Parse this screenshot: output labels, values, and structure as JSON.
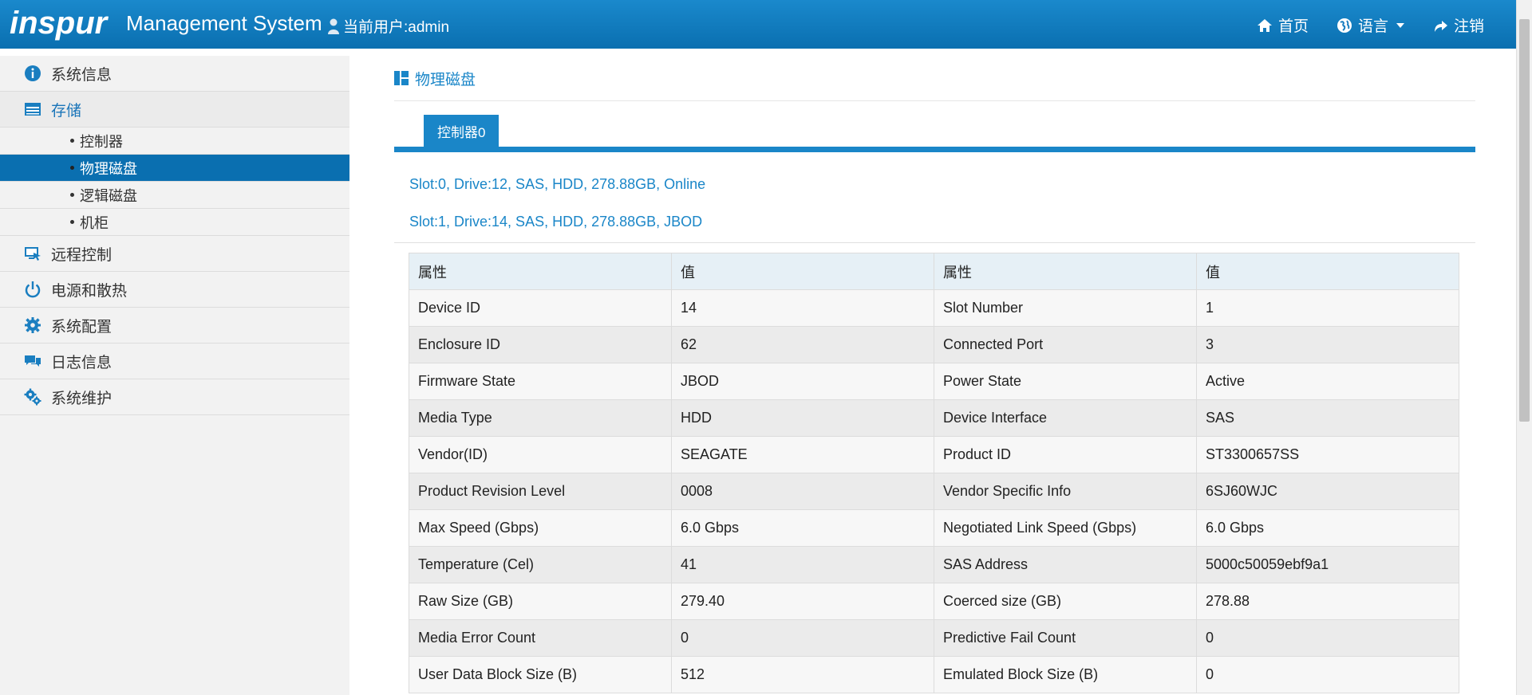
{
  "header": {
    "logo_text": "inspur",
    "app_title": "Management System",
    "user_label": "当前用户:admin",
    "nav": [
      {
        "label": "首页",
        "icon": "home-icon"
      },
      {
        "label": "语言",
        "icon": "globe-icon"
      },
      {
        "label": "注销",
        "icon": "logout-icon"
      }
    ]
  },
  "sidebar": {
    "items": [
      {
        "label": "系统信息",
        "icon": "info-icon"
      },
      {
        "label": "存储",
        "icon": "storage-icon"
      },
      {
        "label": "远程控制",
        "icon": "remote-control-icon"
      },
      {
        "label": "电源和散热",
        "icon": "power-icon"
      },
      {
        "label": "系统配置",
        "icon": "gear-icon"
      },
      {
        "label": "日志信息",
        "icon": "chat-icon"
      },
      {
        "label": "系统维护",
        "icon": "gears-icon"
      }
    ],
    "storage_sub": [
      {
        "label": "控制器"
      },
      {
        "label": "物理磁盘"
      },
      {
        "label": "逻辑磁盘"
      },
      {
        "label": "机柜"
      }
    ]
  },
  "main": {
    "page_title": "物理磁盘",
    "tab_label": "控制器0",
    "drives": [
      "Slot:0, Drive:12, SAS, HDD, 278.88GB, Online",
      "Slot:1, Drive:14, SAS, HDD, 278.88GB, JBOD"
    ],
    "table": {
      "headers": [
        "属性",
        "值",
        "属性",
        "值"
      ],
      "rows": [
        [
          "Device ID",
          "14",
          "Slot Number",
          "1"
        ],
        [
          "Enclosure ID",
          "62",
          "Connected Port",
          "3"
        ],
        [
          "Firmware State",
          "JBOD",
          "Power State",
          "Active"
        ],
        [
          "Media Type",
          "HDD",
          "Device Interface",
          "SAS"
        ],
        [
          "Vendor(ID)",
          "SEAGATE",
          "Product ID",
          "ST3300657SS"
        ],
        [
          "Product Revision Level",
          "0008",
          "Vendor Specific Info",
          "6SJ60WJC"
        ],
        [
          "Max Speed (Gbps)",
          "6.0 Gbps",
          "Negotiated Link Speed (Gbps)",
          "6.0 Gbps"
        ],
        [
          "Temperature (Cel)",
          "41",
          "SAS Address",
          "5000c50059ebf9a1"
        ],
        [
          "Raw Size (GB)",
          "279.40",
          "Coerced size (GB)",
          "278.88"
        ],
        [
          "Media Error Count",
          "0",
          "Predictive Fail Count",
          "0"
        ],
        [
          "User Data Block Size (B)",
          "512",
          "Emulated Block Size (B)",
          "0"
        ]
      ]
    }
  },
  "colors": {
    "header_blue": "#0a6fb0",
    "accent_blue": "#1a86c8",
    "sidebar_bg": "#f2f2f2"
  }
}
